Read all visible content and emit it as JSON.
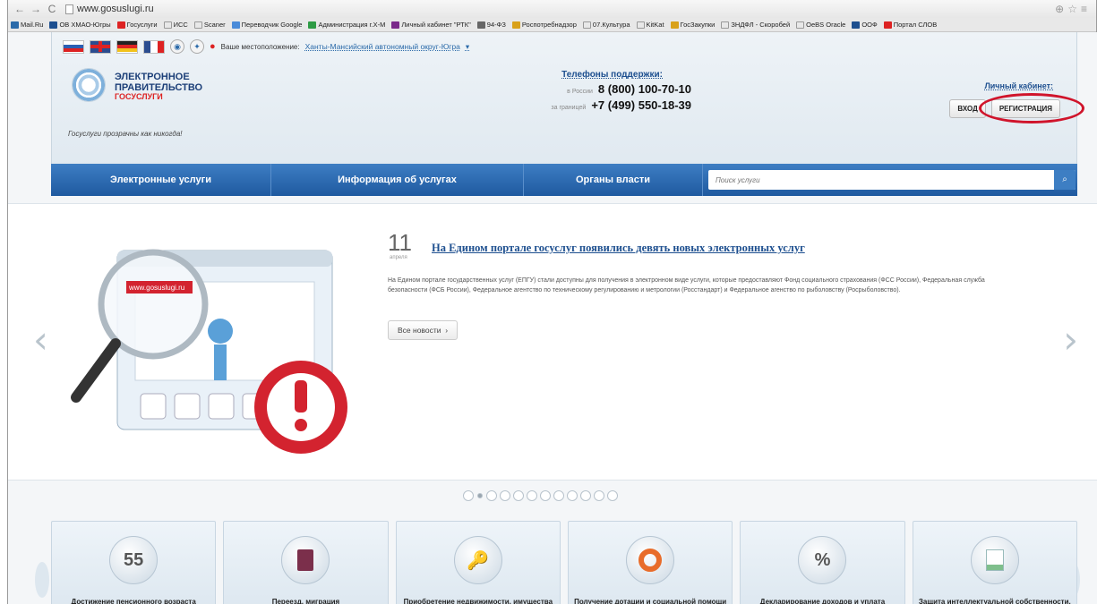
{
  "browser": {
    "url": "www.gosuslugi.ru",
    "bookmarks": [
      "Mail.Ru",
      "ОВ ХМАО-Югры",
      "Госуслуги",
      "ИСС",
      "Scaner",
      "Переводчик Google",
      "Администрация г.Х-М",
      "Личный кабинет \"РТК\"",
      "94-ФЗ",
      "Роспотребнадзор",
      "07.Культура",
      "KitKat",
      "ГосЗакупки",
      "ЗНДФЛ - Скоробей",
      "OeBS Oracle",
      "ООФ",
      "Портал СЛОВ"
    ]
  },
  "header": {
    "location_label": "Ваше местоположение:",
    "location_value": "Ханты-Мансийский автономный округ-Югра",
    "logo_line1": "ЭЛЕКТРОННОЕ",
    "logo_line2": "ПРАВИТЕЛЬСТВО",
    "logo_line3": "ГОСУСЛУГИ",
    "slogan": "Госуслуги прозрачны как никогда!",
    "phones_title": "Телефоны поддержки:",
    "phone_ru_label": "в России",
    "phone_ru": "8 (800) 100-70-10",
    "phone_abroad_label": "за границей",
    "phone_abroad": "+7 (499) 550-18-39",
    "cabinet_title": "Личный кабинет:",
    "login": "ВХОД",
    "register": "РЕГИСТРАЦИЯ"
  },
  "nav": {
    "items": [
      "Электронные услуги",
      "Информация об услугах",
      "Органы власти"
    ],
    "search_placeholder": "Поиск услуги"
  },
  "news": {
    "day": "11",
    "month": "апреля",
    "title": "На Едином портале госуслуг появились девять новых электронных услуг",
    "text": "На Едином портале государственных услуг (ЕПГУ) стали доступны для получения в электронном виде услуги, которые предоставляют Фонд социального страхования (ФСС России), Федеральная служба безопасности (ФСБ России), Федеральное агентство по техническому регулированию и метрологии (Росстандарт) и Федеральное агенство по рыболовству (Росрыболовство).",
    "all_news": "Все новости",
    "illustration_url": "www.gosuslugi.ru",
    "dots_total": 12,
    "dots_active": 2
  },
  "services": [
    {
      "icon": "55",
      "label": "Достижение пенсионного возраста"
    },
    {
      "icon": "",
      "label": "Переезд, миграция"
    },
    {
      "icon": "",
      "label": "Приобретение недвижимости, имущества"
    },
    {
      "icon": "",
      "label": "Получение дотации и социальной помощи"
    },
    {
      "icon": "%",
      "label": "Декларирование доходов и уплата налогов"
    },
    {
      "icon": "",
      "label": "Защита интеллектуальной собственности, патенты"
    }
  ]
}
